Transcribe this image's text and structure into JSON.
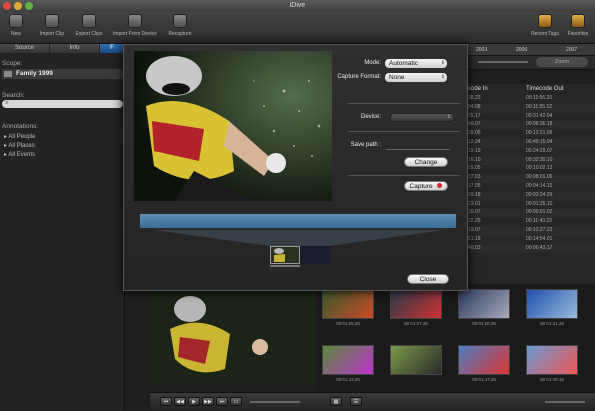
{
  "window": {
    "title": "iDive"
  },
  "toolbar": {
    "left": [
      {
        "label": "New",
        "icon": "new-icon"
      },
      {
        "label": "Import Clip",
        "icon": "import-clip-icon"
      },
      {
        "label": "Export Clips",
        "icon": "export-clips-icon"
      },
      {
        "label": "Import From Device",
        "icon": "import-device-icon"
      },
      {
        "label": "Recapture",
        "icon": "recapture-icon"
      }
    ],
    "right": [
      {
        "label": "Recent Tags",
        "icon": "recent-tags-icon"
      },
      {
        "label": "Favorites",
        "icon": "favorites-icon"
      }
    ]
  },
  "sidebar": {
    "tabs": [
      "Source",
      "Info",
      "F"
    ],
    "scope_label": "Scope:",
    "scope_value": "Family 1999",
    "search_label": "Search:",
    "annotations_label": "Annotations:",
    "annotations": [
      "All People",
      "All Places",
      "All Events"
    ]
  },
  "timeline": {
    "years": [
      "2003",
      "2006",
      "2007"
    ],
    "zoom_label": "Zoom"
  },
  "table": {
    "headers": [
      "code In",
      "Timecode Out"
    ],
    "rows": [
      [
        "38.23",
        "00:11:56.20"
      ],
      [
        "04.08",
        "00:11:55.12"
      ],
      [
        "55.17",
        "00:31:42.04"
      ],
      [
        "49.07",
        "00:06:36.18"
      ],
      [
        "39.05",
        "00:13:21.06"
      ],
      [
        "12.24",
        "00:49:15.04"
      ],
      [
        "19.19",
        "00:24:29.07"
      ],
      [
        "16.10",
        "00:32:30.10"
      ],
      [
        "09.05",
        "00:10:02.13"
      ],
      [
        "37.03",
        "00:08:01.06"
      ],
      [
        "37.05",
        "00:04:14.15"
      ],
      [
        "59.18",
        "00:03:24.29"
      ],
      [
        "23.01",
        "00:01:35.10"
      ],
      [
        "35.07",
        "00:00:01.02"
      ],
      [
        "22.25",
        "00:11:43.22"
      ],
      [
        "19.07",
        "00:13:27.23"
      ],
      [
        "51.18",
        "00:14:54.01"
      ],
      [
        "40.03",
        "00:00:43.17"
      ]
    ]
  },
  "thumbnails": [
    {
      "time": "00:01:05.09"
    },
    {
      "time": "00:01:07.20"
    },
    {
      "time": "00:01:20.26"
    },
    {
      "time": "00:01:41.28"
    },
    {
      "time": "00:01:43.20"
    },
    {
      "time": ""
    },
    {
      "time": "00:01:47.28"
    },
    {
      "time": "00:01:49.15"
    }
  ],
  "capture_dialog": {
    "mode_label": "Mode:",
    "mode_value": "Automatic",
    "format_label": "Capture Format:",
    "format_value": "None",
    "device_label": "Device:",
    "device_value": "",
    "save_path_label": "Save path :",
    "save_path_value": "",
    "change_label": "Change",
    "capture_label": "Capture",
    "close_label": "Close"
  }
}
